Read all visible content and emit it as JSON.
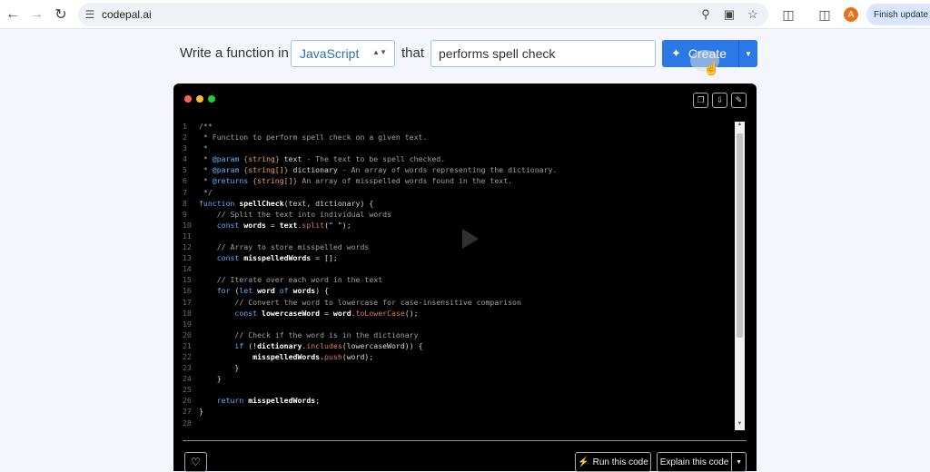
{
  "browser": {
    "url": "codepal.ai",
    "finish_update": "Finish update",
    "avatar_letter": "A"
  },
  "prompt": {
    "prefix": "Write a function in",
    "language": "JavaScript",
    "connector": "that",
    "task": "performs spell check",
    "create_label": "Create"
  },
  "code_lines": [
    {
      "n": "1",
      "parts": [
        [
          "cm",
          "/**"
        ]
      ]
    },
    {
      "n": "2",
      "parts": [
        [
          "cm",
          " * Function to perform spell check on a given text."
        ]
      ]
    },
    {
      "n": "3",
      "parts": [
        [
          "cm",
          " *"
        ]
      ]
    },
    {
      "n": "4",
      "parts": [
        [
          "cm",
          " * "
        ],
        [
          "kw",
          "@param"
        ],
        [
          "cm",
          " {"
        ],
        [
          "ty",
          "string"
        ],
        [
          "cm",
          "} "
        ],
        [
          "st",
          "text"
        ],
        [
          "cm",
          " - The text to be spell checked."
        ]
      ]
    },
    {
      "n": "5",
      "parts": [
        [
          "cm",
          " * "
        ],
        [
          "kw",
          "@param"
        ],
        [
          "cm",
          " {"
        ],
        [
          "ty",
          "string[]"
        ],
        [
          "cm",
          "} "
        ],
        [
          "st",
          "dictionary"
        ],
        [
          "cm",
          " - An array of words representing the dictionary."
        ]
      ]
    },
    {
      "n": "6",
      "parts": [
        [
          "cm",
          " * "
        ],
        [
          "kw",
          "@returns"
        ],
        [
          "cm",
          " {"
        ],
        [
          "ty",
          "string[]"
        ],
        [
          "cm",
          "} An array of misspelled words found in the text."
        ]
      ]
    },
    {
      "n": "7",
      "parts": [
        [
          "cm",
          " */"
        ]
      ]
    },
    {
      "n": "8",
      "parts": [
        [
          "kw",
          "function "
        ],
        [
          "fn",
          "spellCheck"
        ],
        [
          "st",
          "(text, dictionary) {"
        ]
      ]
    },
    {
      "n": "9",
      "parts": [
        [
          "cm",
          "    // Split the text into individual words"
        ]
      ]
    },
    {
      "n": "10",
      "parts": [
        [
          "kw",
          "    const "
        ],
        [
          "fn",
          "words"
        ],
        [
          "st",
          " = "
        ],
        [
          "fn",
          "text"
        ],
        [
          "st",
          "."
        ],
        [
          "mt",
          "split"
        ],
        [
          "st",
          "(\" \");"
        ]
      ]
    },
    {
      "n": "11",
      "parts": [
        [
          "st",
          ""
        ]
      ]
    },
    {
      "n": "12",
      "parts": [
        [
          "cm",
          "    // Array to store misspelled words"
        ]
      ]
    },
    {
      "n": "13",
      "parts": [
        [
          "kw",
          "    const "
        ],
        [
          "fn",
          "misspelledWords"
        ],
        [
          "st",
          " = [];"
        ]
      ]
    },
    {
      "n": "14",
      "parts": [
        [
          "st",
          ""
        ]
      ]
    },
    {
      "n": "15",
      "parts": [
        [
          "cm",
          "    // Iterate over each word in the text"
        ]
      ]
    },
    {
      "n": "16",
      "parts": [
        [
          "kw",
          "    for "
        ],
        [
          "st",
          "("
        ],
        [
          "kw",
          "let "
        ],
        [
          "fn",
          "word"
        ],
        [
          "kw",
          " of "
        ],
        [
          "fn",
          "words"
        ],
        [
          "st",
          ") {"
        ]
      ]
    },
    {
      "n": "17",
      "parts": [
        [
          "cm",
          "        // Convert the word to lowercase for case-insensitive comparison"
        ]
      ]
    },
    {
      "n": "18",
      "parts": [
        [
          "kw",
          "        const "
        ],
        [
          "fn",
          "lowercaseWord"
        ],
        [
          "st",
          " = "
        ],
        [
          "fn",
          "word"
        ],
        [
          "st",
          "."
        ],
        [
          "mt",
          "toLowerCase"
        ],
        [
          "st",
          "();"
        ]
      ]
    },
    {
      "n": "19",
      "parts": [
        [
          "st",
          ""
        ]
      ]
    },
    {
      "n": "20",
      "parts": [
        [
          "cm",
          "        // Check if the word is in the dictionary"
        ]
      ]
    },
    {
      "n": "21",
      "parts": [
        [
          "kw",
          "        if "
        ],
        [
          "st",
          "(!"
        ],
        [
          "fn",
          "dictionary"
        ],
        [
          "st",
          "."
        ],
        [
          "mt",
          "includes"
        ],
        [
          "st",
          "(lowercaseWord)) {"
        ]
      ]
    },
    {
      "n": "22",
      "parts": [
        [
          "st",
          "            "
        ],
        [
          "fn",
          "misspelledWords"
        ],
        [
          "st",
          "."
        ],
        [
          "mt",
          "push"
        ],
        [
          "st",
          "(word);"
        ]
      ]
    },
    {
      "n": "23",
      "parts": [
        [
          "st",
          "        }"
        ]
      ]
    },
    {
      "n": "24",
      "parts": [
        [
          "st",
          "    }"
        ]
      ]
    },
    {
      "n": "25",
      "parts": [
        [
          "st",
          ""
        ]
      ]
    },
    {
      "n": "26",
      "parts": [
        [
          "kw",
          "    return "
        ],
        [
          "fn",
          "misspelledWords"
        ],
        [
          "st",
          ";"
        ]
      ]
    },
    {
      "n": "27",
      "parts": [
        [
          "st",
          "}"
        ]
      ]
    },
    {
      "n": "28",
      "parts": [
        [
          "st",
          ""
        ]
      ]
    }
  ],
  "footer": {
    "run_label": "Run this code",
    "explain_label": "Explain this code"
  },
  "colors": {
    "accent": "#2c78e4",
    "code_bg": "#000000",
    "keyword": "#5fb3ff"
  }
}
